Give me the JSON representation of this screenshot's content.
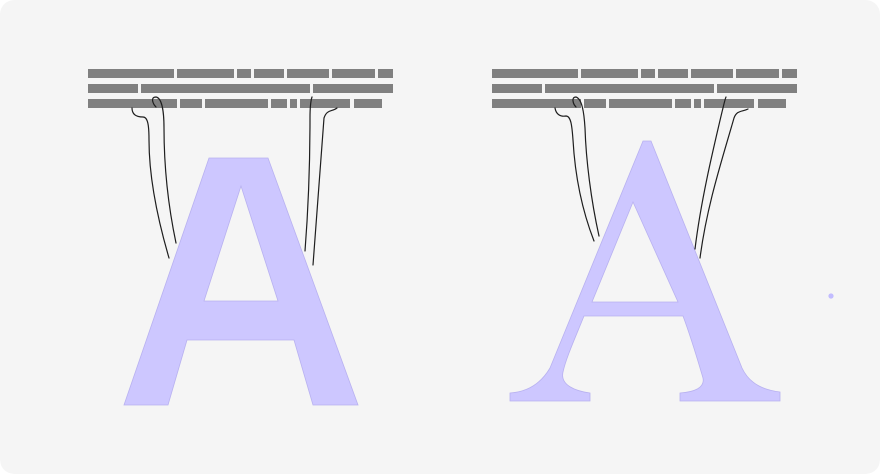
{
  "colors": {
    "background": "#f5f5f5",
    "bar": "#808080",
    "glyph_fill": "#cdc7ff",
    "glyph_stroke": "#b8b1f0",
    "line": "#1e1e1e",
    "dot": "#c2bcff"
  },
  "panels": [
    {
      "id": "sans-serif-panel",
      "glyph": "A",
      "glyph_style": "sans-serif",
      "text_line_count": 3,
      "connector_count": 2
    },
    {
      "id": "serif-panel",
      "glyph": "A",
      "glyph_style": "serif",
      "text_line_count": 3,
      "connector_count": 2
    }
  ],
  "icons": [
    "dot-icon"
  ]
}
